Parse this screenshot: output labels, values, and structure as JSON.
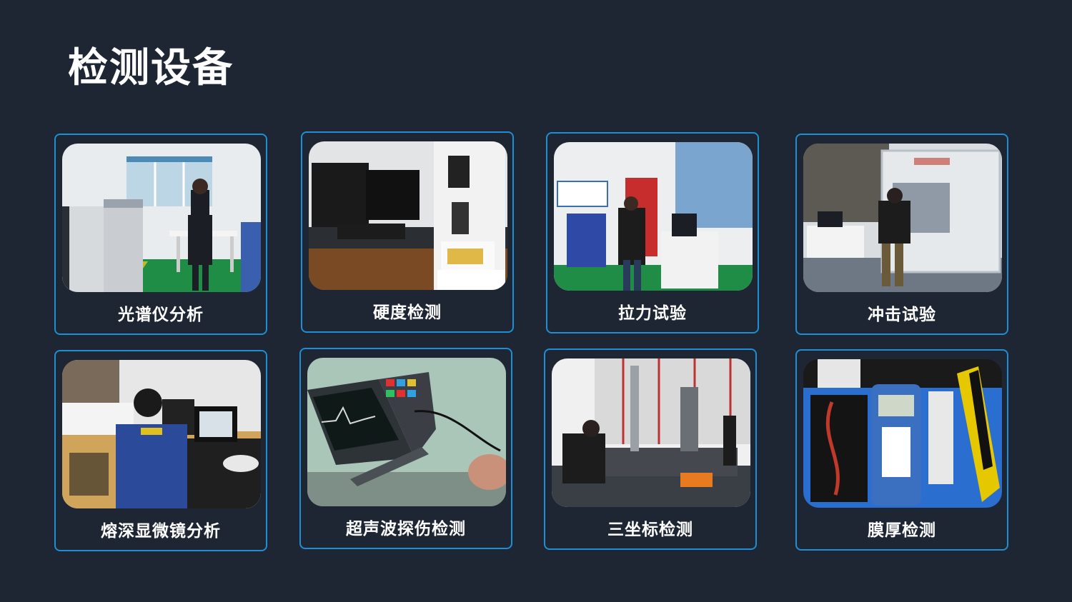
{
  "page": {
    "title": "检测设备"
  },
  "colors": {
    "background": "#1e2533",
    "card_border": "#1c8fd6",
    "text": "#ffffff"
  },
  "cards": [
    {
      "label": "光谱仪分析",
      "icon": "spectrometer-photo"
    },
    {
      "label": "硬度检测",
      "icon": "hardness-tester-photo"
    },
    {
      "label": "拉力试验",
      "icon": "tensile-tester-photo"
    },
    {
      "label": "冲击试验",
      "icon": "impact-tester-photo"
    },
    {
      "label": "熔深显微镜分析",
      "icon": "microscope-photo"
    },
    {
      "label": "超声波探伤检测",
      "icon": "ultrasonic-flaw-detector-photo"
    },
    {
      "label": "三坐标检测",
      "icon": "cmm-photo"
    },
    {
      "label": "膜厚检测",
      "icon": "thickness-gauge-photo"
    }
  ]
}
